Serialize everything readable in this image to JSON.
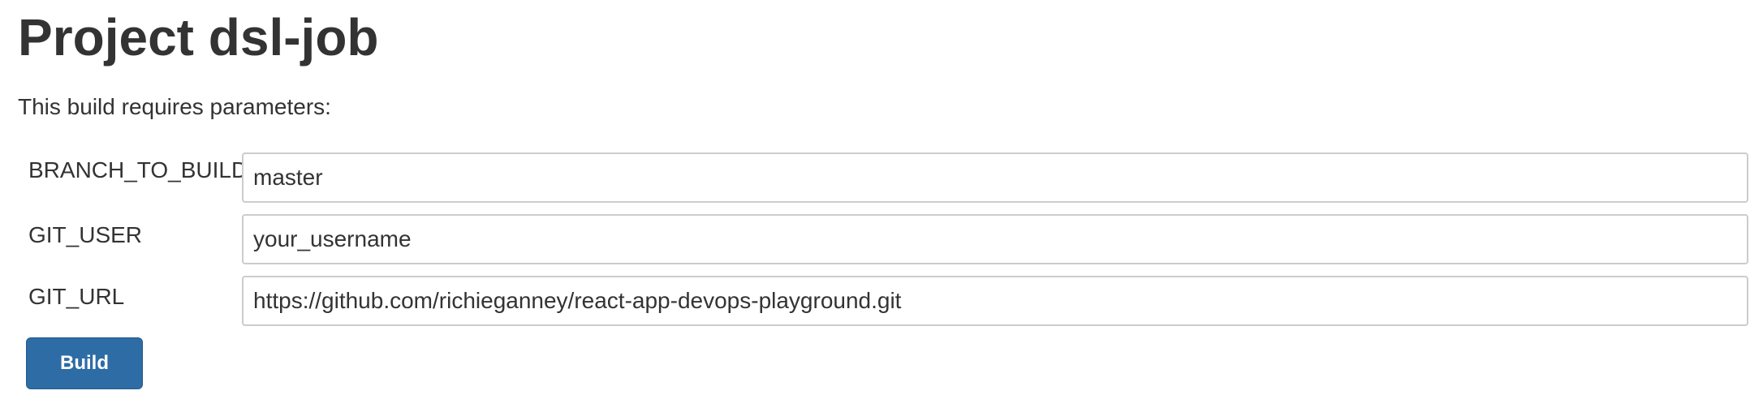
{
  "page": {
    "title": "Project dsl-job",
    "intro": "This build requires parameters:"
  },
  "parameters": [
    {
      "name": "BRANCH_TO_BUILD",
      "value": "master"
    },
    {
      "name": "GIT_USER",
      "value": "your_username"
    },
    {
      "name": "GIT_URL",
      "value": "https://github.com/richieganney/react-app-devops-playground.git"
    }
  ],
  "actions": {
    "build_label": "Build"
  },
  "colors": {
    "text": "#333333",
    "input_border": "#cccccc",
    "button_background": "#2d6ca5",
    "button_text": "#ffffff"
  }
}
